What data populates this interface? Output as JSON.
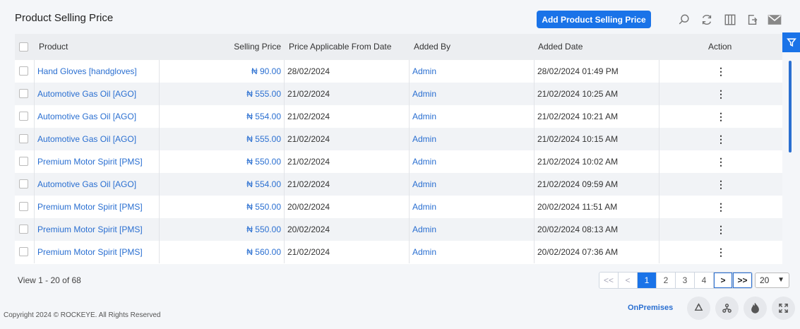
{
  "header": {
    "title": "Product Selling Price",
    "add_button": "Add Product Selling Price"
  },
  "toolbar_icons": [
    "search-icon",
    "refresh-icon",
    "columns-icon",
    "export-icon",
    "email-icon"
  ],
  "columns": {
    "product": "Product",
    "selling_price": "Selling Price",
    "price_from": "Price Applicable From Date",
    "added_by": "Added By",
    "added_date": "Added Date",
    "action": "Action"
  },
  "rows": [
    {
      "product": "Hand Gloves [handgloves]",
      "price": "₦ 90.00",
      "from": "28/02/2024",
      "by": "Admin",
      "date": "28/02/2024 01:49 PM"
    },
    {
      "product": "Automotive Gas Oil [AGO]",
      "price": "₦ 555.00",
      "from": "21/02/2024",
      "by": "Admin",
      "date": "21/02/2024 10:25 AM"
    },
    {
      "product": "Automotive Gas Oil [AGO]",
      "price": "₦ 554.00",
      "from": "21/02/2024",
      "by": "Admin",
      "date": "21/02/2024 10:21 AM"
    },
    {
      "product": "Automotive Gas Oil [AGO]",
      "price": "₦ 555.00",
      "from": "21/02/2024",
      "by": "Admin",
      "date": "21/02/2024 10:15 AM"
    },
    {
      "product": "Premium Motor Spirit [PMS]",
      "price": "₦ 550.00",
      "from": "21/02/2024",
      "by": "Admin",
      "date": "21/02/2024 10:02 AM"
    },
    {
      "product": "Automotive Gas Oil [AGO]",
      "price": "₦ 554.00",
      "from": "21/02/2024",
      "by": "Admin",
      "date": "21/02/2024 09:59 AM"
    },
    {
      "product": "Premium Motor Spirit [PMS]",
      "price": "₦ 550.00",
      "from": "20/02/2024",
      "by": "Admin",
      "date": "20/02/2024 11:51 AM"
    },
    {
      "product": "Premium Motor Spirit [PMS]",
      "price": "₦ 550.00",
      "from": "20/02/2024",
      "by": "Admin",
      "date": "20/02/2024 08:13 AM"
    },
    {
      "product": "Premium Motor Spirit [PMS]",
      "price": "₦ 560.00",
      "from": "21/02/2024",
      "by": "Admin",
      "date": "20/02/2024 07:36 AM"
    }
  ],
  "pager": {
    "info": "View 1 - 20 of 68",
    "first": "<<",
    "prev": "<",
    "pages": [
      "1",
      "2",
      "3",
      "4"
    ],
    "current": "1",
    "next": ">",
    "last": ">>",
    "page_size": "20"
  },
  "footer": {
    "copyright": "Copyright 2024 © ROCKEYE. All Rights Reserved",
    "mode": "OnPremises"
  },
  "colors": {
    "accent": "#1a73e8",
    "link": "#2a6fd1"
  }
}
